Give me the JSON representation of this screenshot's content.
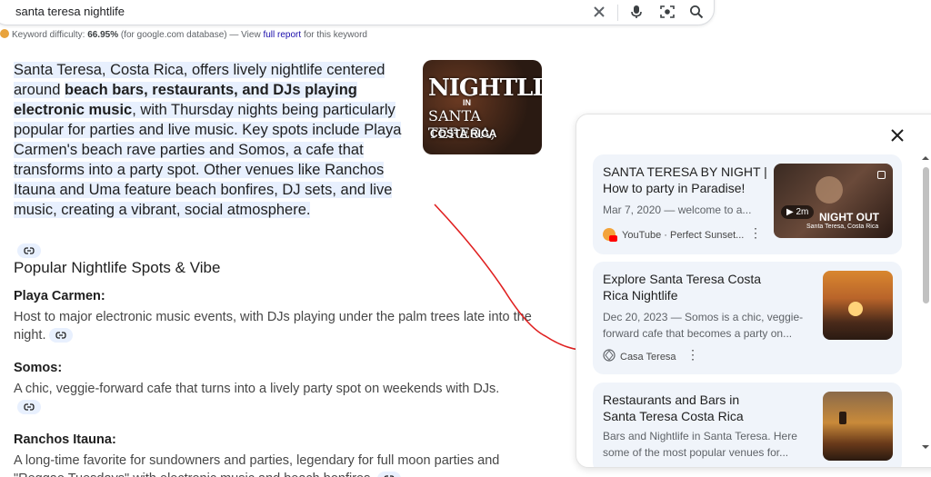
{
  "search": {
    "query": "santa teresa nightlife"
  },
  "keyword": {
    "prefix": "Keyword difficulty:",
    "value": "66.95%",
    "middle": "(for google.com database) — View",
    "link": "full report",
    "suffix": "for this keyword"
  },
  "answer": {
    "p1": "Santa Teresa, Costa Rica, offers lively nightlife centered around",
    "p1_bold": "beach bars, restaurants, and DJs playing electronic music",
    "p2": ", with Thursday nights being particularly popular for parties and live music. Key spots include Playa Carmen's beach rave parties and Somos, a cafe that transforms into a party spot. Other venues like Ranchos Itauna and Uma feature beach bonfires, DJ sets, and live music, creating a vibrant, social atmosphere.",
    "thumb_line1": "NIGHTLIFE",
    "thumb_line2": "IN",
    "thumb_line3": "SANTA TERESA,",
    "thumb_line4": "COSTA RICA"
  },
  "section": {
    "title": "Popular Nightlife Spots & Vibe",
    "spots": [
      {
        "name": "Playa Carmen:",
        "desc": "Host to major electronic music events, with DJs playing under the palm trees late into the night."
      },
      {
        "name": "Somos:",
        "desc": "A chic, veggie-forward cafe that turns into a lively party spot on weekends with DJs."
      },
      {
        "name": "Ranchos Itauna:",
        "desc": "A long-time favorite for sundowners and parties, legendary for full moon parties and \"Reggae Tuesdays\" with electronic music and beach bonfires."
      }
    ]
  },
  "panel": {
    "cards": [
      {
        "title": "SANTA TERESA BY NIGHT | How to party in Paradise!",
        "desc": "Mar 7, 2020 — welcome to a...",
        "source": "YouTube · Perfect Sunset...",
        "duration": "2m",
        "img_text": "NIGHT OUT",
        "img_sub": "Santa Teresa, Costa Rica"
      },
      {
        "title": "Explore Santa Teresa Costa Rica Nightlife",
        "desc": "Dec 20, 2023 — Somos is a chic, veggie-forward cafe that becomes a party on...",
        "source": "Casa Teresa"
      },
      {
        "title": "Restaurants and Bars in Santa Teresa Costa Rica",
        "desc": "Bars and Nightlife in Santa Teresa. Here some of the most popular venues for..."
      }
    ]
  },
  "colors": {
    "highlight": "#e8f0fe",
    "link": "#1a0dab",
    "annotation": "#e02020"
  }
}
